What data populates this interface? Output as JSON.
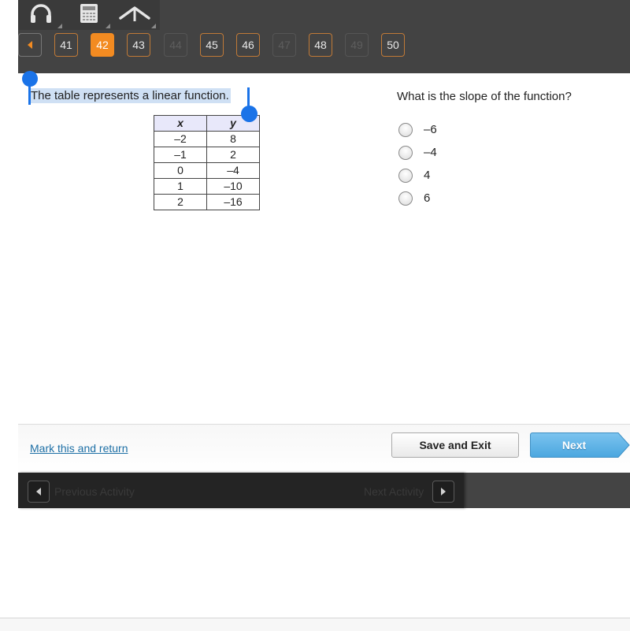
{
  "toolbar": {
    "tools": [
      {
        "name": "headphones",
        "icon": "headphones-icon"
      },
      {
        "name": "calculator",
        "icon": "calculator-icon"
      },
      {
        "name": "reference",
        "icon": "caret-up-icon"
      }
    ]
  },
  "question_nav": {
    "prev_icon": "triangle-left-icon",
    "current": "42",
    "items": [
      {
        "label": "41",
        "state": "answered"
      },
      {
        "label": "42",
        "state": "current"
      },
      {
        "label": "43",
        "state": "answered"
      },
      {
        "label": "44",
        "state": "disabled"
      },
      {
        "label": "45",
        "state": "answered"
      },
      {
        "label": "46",
        "state": "answered"
      },
      {
        "label": "47",
        "state": "disabled"
      },
      {
        "label": "48",
        "state": "answered"
      },
      {
        "label": "49",
        "state": "disabled"
      },
      {
        "label": "50",
        "state": "answered"
      }
    ]
  },
  "prompt": {
    "text": "The table represents a linear function."
  },
  "table": {
    "headers": [
      "x",
      "y"
    ],
    "rows": [
      [
        "–2",
        "8"
      ],
      [
        "–1",
        "2"
      ],
      [
        "0",
        "–4"
      ],
      [
        "1",
        "–10"
      ],
      [
        "2",
        "–16"
      ]
    ]
  },
  "question": {
    "text": "What is the slope of the function?",
    "choices": [
      "–6",
      "–4",
      "4",
      "6"
    ]
  },
  "footer": {
    "mark_label": "Mark this and return",
    "save_label": "Save and Exit",
    "next_label": "Next"
  },
  "activity_bar": {
    "previous_label": "Previous Activity",
    "next_label": "Next Activity"
  },
  "colors": {
    "accent_orange": "#f38b21",
    "selection_blue": "#1a73e8",
    "next_blue": "#5db3e6",
    "link_blue": "#1d6fa5"
  }
}
